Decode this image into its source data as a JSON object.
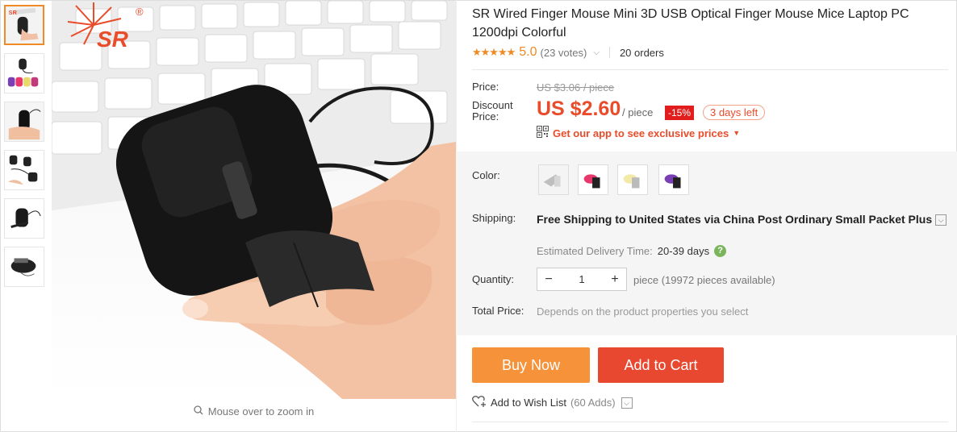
{
  "brand": {
    "logo_text": "SR",
    "registered_mark": "®"
  },
  "gallery": {
    "thumbnails": [
      {
        "name": "thumb-1",
        "active": true
      },
      {
        "name": "thumb-2",
        "active": false
      },
      {
        "name": "thumb-3",
        "active": false
      },
      {
        "name": "thumb-4",
        "active": false
      },
      {
        "name": "thumb-5",
        "active": false
      },
      {
        "name": "thumb-6",
        "active": false
      }
    ],
    "zoom_hint": "Mouse over to zoom in",
    "zoom_icon": "magnifier-icon"
  },
  "product": {
    "title": "SR Wired Finger Mouse Mini 3D USB Optical Finger Mouse Mice Laptop PC 1200dpi Colorful",
    "stars": "★★★★★",
    "rating": "5.0",
    "votes": "(23 votes)",
    "orders": "20 orders"
  },
  "pricing": {
    "price_label": "Price:",
    "original_price": "US $3.06 / piece",
    "discount_label_line1": "Discount",
    "discount_label_line2": "Price:",
    "discount_price": "US $2.60",
    "per_piece": "/ piece",
    "discount_badge": "-15%",
    "days_left": "3 days left",
    "app_link": "Get our app to see exclusive prices",
    "app_icon": "qr-code-icon"
  },
  "options": {
    "color_label": "Color:",
    "colors": [
      {
        "name": "silver",
        "hex": "#bfbfbf"
      },
      {
        "name": "pink",
        "hex": "#e8386b"
      },
      {
        "name": "yellow",
        "hex": "#f3e9a8"
      },
      {
        "name": "purple",
        "hex": "#7a3fb3"
      }
    ],
    "shipping_label": "Shipping:",
    "shipping_text": "Free Shipping to United States via China Post Ordinary Small Packet Plus",
    "delivery_label": "Estimated Delivery Time:",
    "delivery_days": "20-39 days",
    "help_icon": "?",
    "quantity_label": "Quantity:",
    "quantity_value": "1",
    "minus": "−",
    "plus": "+",
    "availability": "piece (19972 pieces available)",
    "total_label": "Total Price:",
    "total_note": "Depends on the product properties you select"
  },
  "actions": {
    "buy_now": "Buy Now",
    "add_to_cart": "Add to Cart",
    "wish_label": "Add to Wish List",
    "wish_adds": "(60 Adds)"
  },
  "colors": {
    "accent_orange": "#f5923a",
    "accent_red": "#e8482f",
    "price_red": "#e94c2b",
    "star_orange": "#f08a24"
  }
}
